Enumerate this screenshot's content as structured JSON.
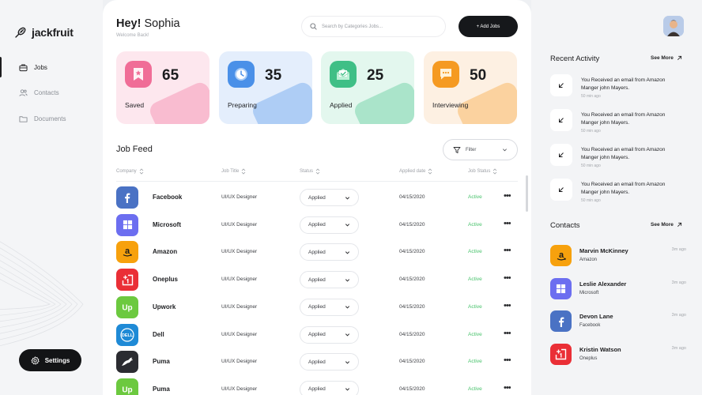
{
  "brand": {
    "name": "jackfruit"
  },
  "nav": [
    {
      "label": "Jobs",
      "active": true,
      "icon": "briefcase-icon"
    },
    {
      "label": "Contacts",
      "active": false,
      "icon": "users-icon"
    },
    {
      "label": "Documents",
      "active": false,
      "icon": "folder-icon"
    }
  ],
  "settings_label": "Settings",
  "header": {
    "greeting_prefix": "Hey!",
    "user_name": "Sophia",
    "subtitle": "Welcome Back!",
    "search_placeholder": "Search by Categories Jobs...",
    "add_button": "+ Add Jobs"
  },
  "stats": [
    {
      "value": "65",
      "label": "Saved",
      "bg": "#fde7ee",
      "icon_bg": "#f06d97",
      "icon": "badge-icon"
    },
    {
      "value": "35",
      "label": "Preparing",
      "bg": "#e4eefc",
      "icon_bg": "#4a90e8",
      "icon": "clock-icon"
    },
    {
      "value": "25",
      "label": "Applied",
      "bg": "#e3f7ee",
      "icon_bg": "#3fbf86",
      "icon": "envelope-icon"
    },
    {
      "value": "50",
      "label": "Interviewing",
      "bg": "#fdf0e2",
      "icon_bg": "#f59a22",
      "icon": "chat-icon"
    }
  ],
  "feed": {
    "title": "Job Feed",
    "filter_label": "Filter",
    "columns": [
      "Company",
      "Job Title",
      "Status",
      "Applied date",
      "Job Status"
    ],
    "rows": [
      {
        "company": "Facebook",
        "title": "UI/UX Designer",
        "status": "Applied",
        "date": "04/15/2020",
        "job_status": "Active",
        "logo_bg": "#4a72c4",
        "logo": "facebook-logo-icon"
      },
      {
        "company": "Microsoft",
        "title": "UI/UX Designer",
        "status": "Applied",
        "date": "04/15/2020",
        "job_status": "Active",
        "logo_bg": "#6c6ef0",
        "logo": "microsoft-logo-icon"
      },
      {
        "company": "Amazon",
        "title": "UI/UX Designer",
        "status": "Applied",
        "date": "04/15/2020",
        "job_status": "Active",
        "logo_bg": "#f7a10d",
        "logo": "amazon-logo-icon"
      },
      {
        "company": "Oneplus",
        "title": "UI/UX Designer",
        "status": "Applied",
        "date": "04/15/2020",
        "job_status": "Active",
        "logo_bg": "#ea2f36",
        "logo": "oneplus-logo-icon"
      },
      {
        "company": "Upwork",
        "title": "UI/UX Designer",
        "status": "Applied",
        "date": "04/15/2020",
        "job_status": "Active",
        "logo_bg": "#6cc93f",
        "logo": "upwork-logo-icon"
      },
      {
        "company": "Dell",
        "title": "UI/UX Designer",
        "status": "Applied",
        "date": "04/15/2020",
        "job_status": "Active",
        "logo_bg": "#1f8ad6",
        "logo": "dell-logo-icon"
      },
      {
        "company": "Puma",
        "title": "UI/UX Designer",
        "status": "Applied",
        "date": "04/15/2020",
        "job_status": "Active",
        "logo_bg": "#2b2c31",
        "logo": "puma-logo-icon"
      },
      {
        "company": "Puma",
        "title": "UI/UX Designer",
        "status": "Applied",
        "date": "04/15/2020",
        "job_status": "Active",
        "logo_bg": "#6cc93f",
        "logo": "upwork-logo-icon"
      }
    ]
  },
  "activity": {
    "title": "Recent Activity",
    "see_more": "See More",
    "items": [
      {
        "text": "You Received an email from Amazon Manger john Mayers.",
        "time": "50 min ago"
      },
      {
        "text": "You Received an email from Amazon Manger john Mayers.",
        "time": "50 min ago"
      },
      {
        "text": "You Received an email from Amazon Manger john Mayers.",
        "time": "50 min ago"
      },
      {
        "text": "You Received an email from Amazon Manger john Mayers.",
        "time": "50 min ago"
      }
    ]
  },
  "contacts": {
    "title": "Contacts",
    "see_more": "See More",
    "items": [
      {
        "name": "Marvin McKinney",
        "company": "Amazon",
        "time": "3m ago",
        "logo_bg": "#f7a10d",
        "logo": "amazon-logo-icon"
      },
      {
        "name": "Leslie Alexander",
        "company": "Microsoft",
        "time": "3m ago",
        "logo_bg": "#6c6ef0",
        "logo": "microsoft-logo-icon"
      },
      {
        "name": "Devon Lane",
        "company": "Facebook",
        "time": "3m ago",
        "logo_bg": "#4a72c4",
        "logo": "facebook-logo-icon"
      },
      {
        "name": "Kristin Watson",
        "company": "Oneplus",
        "time": "3m ago",
        "logo_bg": "#ea2f36",
        "logo": "oneplus-logo-icon"
      }
    ]
  }
}
